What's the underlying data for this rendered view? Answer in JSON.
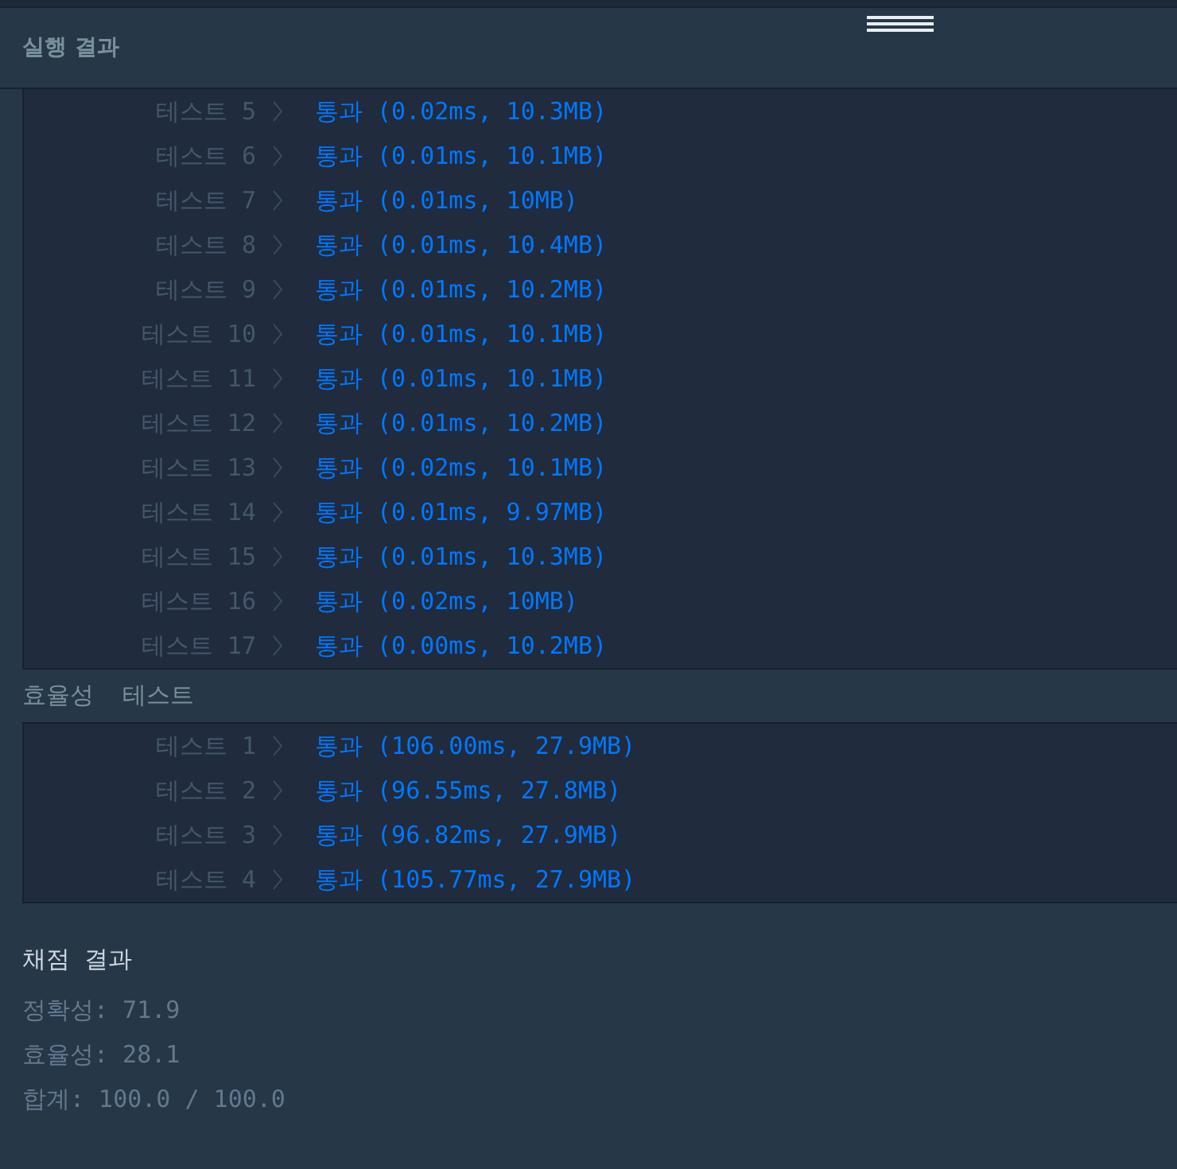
{
  "header": {
    "title": "실행 결과"
  },
  "accuracy_tests": [
    {
      "label": "테스트 5",
      "result": "통과",
      "detail": "(0.02ms, 10.3MB)"
    },
    {
      "label": "테스트 6",
      "result": "통과",
      "detail": "(0.01ms, 10.1MB)"
    },
    {
      "label": "테스트 7",
      "result": "통과",
      "detail": "(0.01ms, 10MB)"
    },
    {
      "label": "테스트 8",
      "result": "통과",
      "detail": "(0.01ms, 10.4MB)"
    },
    {
      "label": "테스트 9",
      "result": "통과",
      "detail": "(0.01ms, 10.2MB)"
    },
    {
      "label": "테스트 10",
      "result": "통과",
      "detail": "(0.01ms, 10.1MB)"
    },
    {
      "label": "테스트 11",
      "result": "통과",
      "detail": "(0.01ms, 10.1MB)"
    },
    {
      "label": "테스트 12",
      "result": "통과",
      "detail": "(0.01ms, 10.2MB)"
    },
    {
      "label": "테스트 13",
      "result": "통과",
      "detail": "(0.02ms, 10.1MB)"
    },
    {
      "label": "테스트 14",
      "result": "통과",
      "detail": "(0.01ms, 9.97MB)"
    },
    {
      "label": "테스트 15",
      "result": "통과",
      "detail": "(0.01ms, 10.3MB)"
    },
    {
      "label": "테스트 16",
      "result": "통과",
      "detail": "(0.02ms, 10MB)"
    },
    {
      "label": "테스트 17",
      "result": "통과",
      "detail": "(0.00ms, 10.2MB)"
    }
  ],
  "efficiency_heading": "효율성  테스트",
  "efficiency_tests": [
    {
      "label": "테스트 1",
      "result": "통과",
      "detail": "(106.00ms, 27.9MB)"
    },
    {
      "label": "테스트 2",
      "result": "통과",
      "detail": "(96.55ms, 27.8MB)"
    },
    {
      "label": "테스트 3",
      "result": "통과",
      "detail": "(96.82ms, 27.9MB)"
    },
    {
      "label": "테스트 4",
      "result": "통과",
      "detail": "(105.77ms, 27.9MB)"
    }
  ],
  "grading": {
    "title": "채점 결과",
    "lines": [
      "정확성: 71.9",
      "효율성: 28.1",
      "합계: 100.0 / 100.0"
    ]
  }
}
